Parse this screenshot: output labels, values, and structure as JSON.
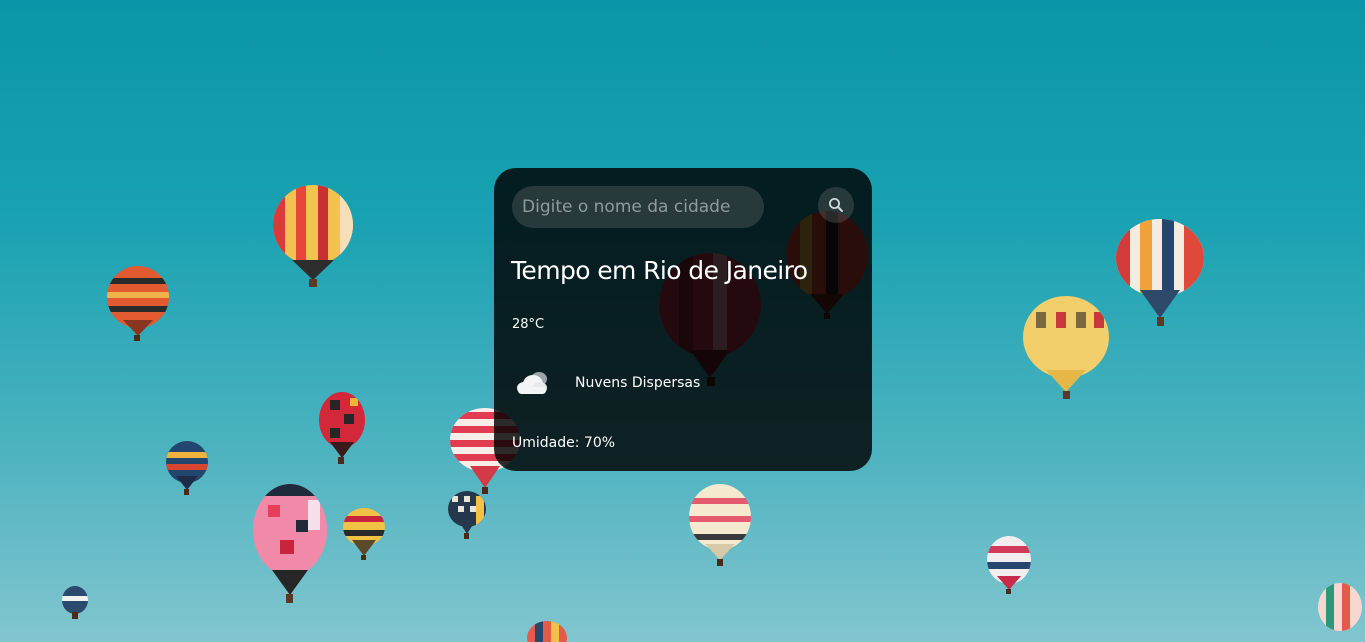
{
  "search": {
    "placeholder": "Digite o nome da cidade",
    "value": ""
  },
  "weather": {
    "title": "Tempo em Rio de Janeiro",
    "temperature": "28°C",
    "description": "Nuvens Dispersas",
    "humidity": "Umidade: 70%",
    "icon": "scattered-clouds-icon"
  },
  "colors": {
    "sky_top": "#0a96a8",
    "sky_bottom": "#82c6cf",
    "card_background": "rgba(0,0,0,0.82)",
    "text": "#ffffff"
  }
}
